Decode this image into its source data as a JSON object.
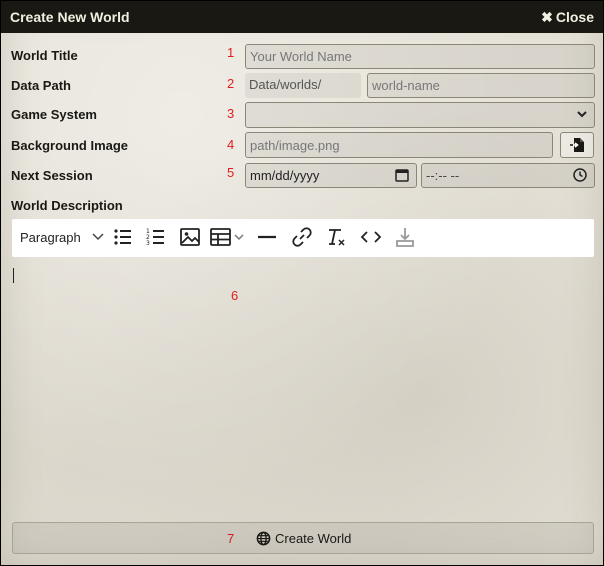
{
  "window": {
    "title": "Create New World",
    "close_label": "Close",
    "close_icon": "times-icon"
  },
  "form": {
    "world_title": {
      "label": "World Title",
      "number": "1",
      "placeholder": "Your World Name"
    },
    "data_path": {
      "label": "Data Path",
      "number": "2",
      "prefix": "Data/worlds/",
      "placeholder": "world-name"
    },
    "game_system": {
      "label": "Game System",
      "number": "3",
      "value": ""
    },
    "background_image": {
      "label": "Background Image",
      "number": "4",
      "placeholder": "path/image.png",
      "picker_icon": "file-import-icon"
    },
    "next_session": {
      "label": "Next Session",
      "number": "5",
      "date_placeholder": "mm/dd/yyyy",
      "time_placeholder": "--:-- --"
    },
    "world_description": {
      "label": "World Description",
      "number": "6"
    }
  },
  "editor": {
    "block_format": "Paragraph",
    "toolbar_icons": [
      "bullet-list-icon",
      "numbered-list-icon",
      "image-icon",
      "table-icon",
      "horizontal-rule-icon",
      "link-icon",
      "clear-format-icon",
      "code-icon",
      "save-icon"
    ]
  },
  "footer": {
    "number": "7",
    "create_label": "Create World",
    "create_icon": "globe-icon"
  },
  "colors": {
    "titlebar_bg": "#191813",
    "annotation_numbers": "#e02020",
    "parchment": "#e6e2d8"
  }
}
